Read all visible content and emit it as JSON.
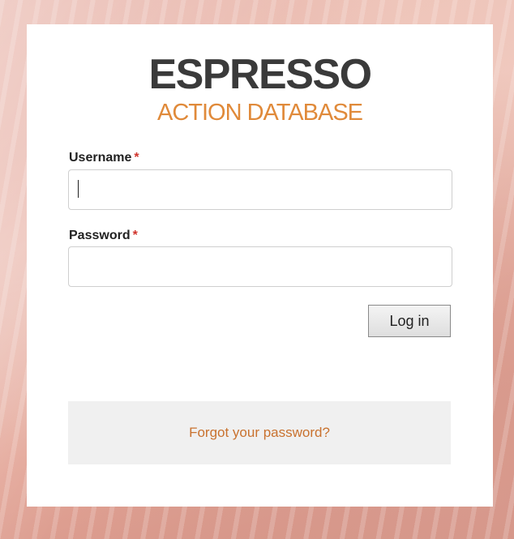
{
  "logo": {
    "main": "ESPRESSO",
    "sub": "ACTION DATABASE"
  },
  "form": {
    "username_label": "Username",
    "password_label": "Password",
    "required_marker": "*",
    "username_value": "",
    "password_value": "",
    "login_label": "Log in",
    "forgot_label": "Forgot your password?"
  },
  "colors": {
    "brand_dark": "#3a3a3a",
    "brand_accent": "#e08a3a",
    "link": "#c9722f",
    "required": "#d0342c"
  }
}
